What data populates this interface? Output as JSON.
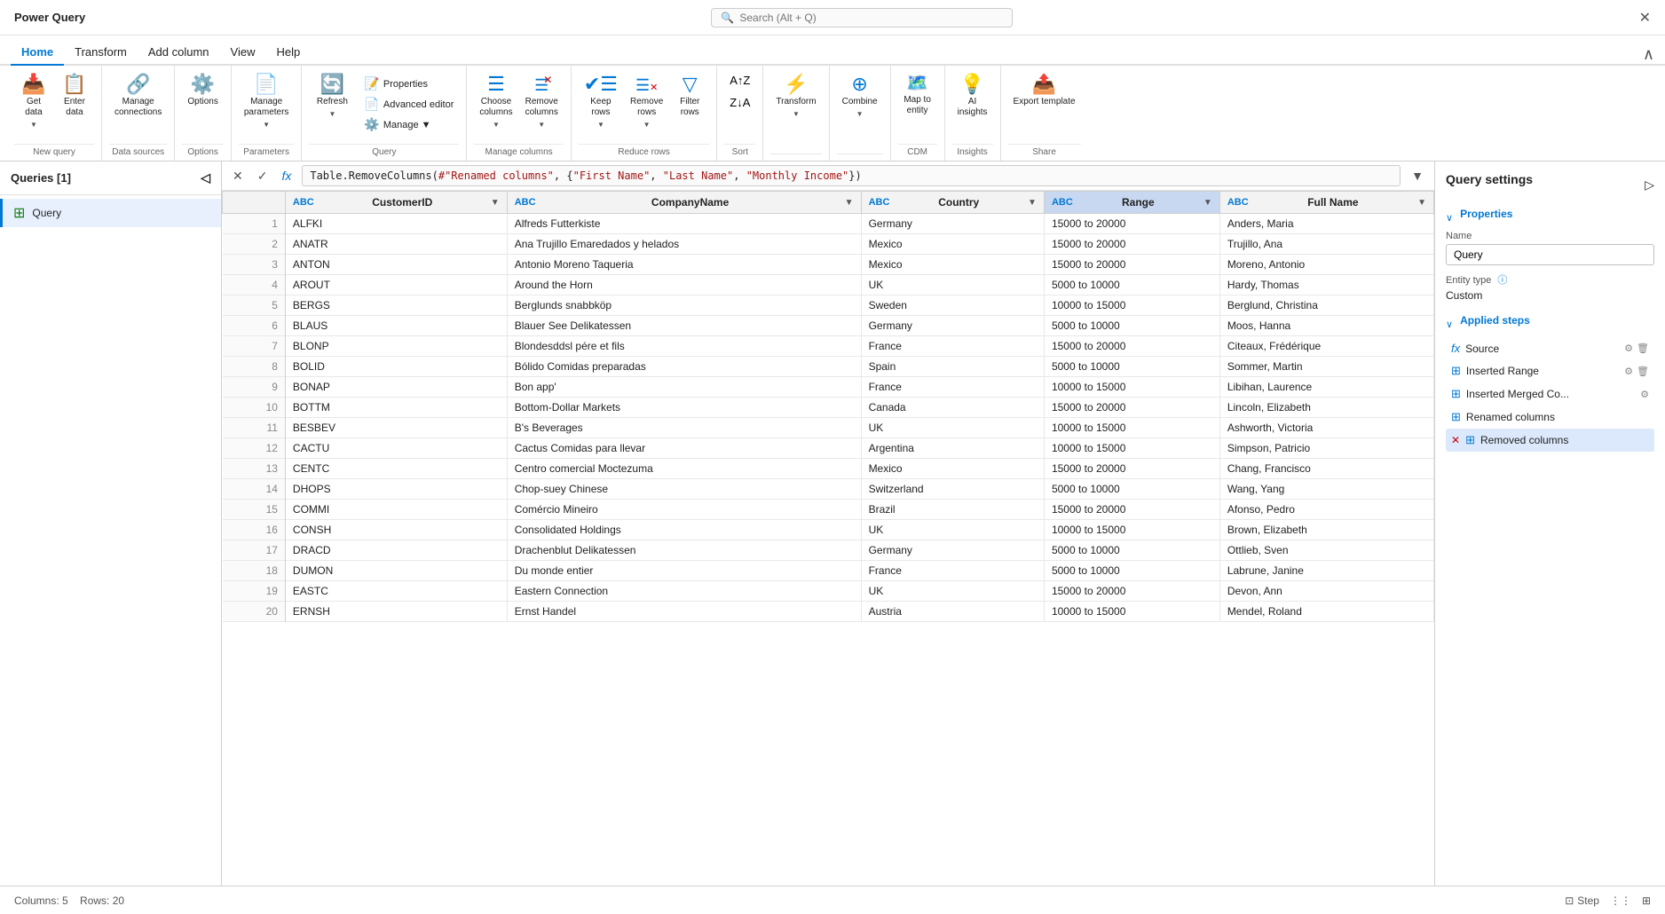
{
  "app": {
    "title": "Power Query",
    "search_placeholder": "Search (Alt + Q)"
  },
  "menu": {
    "items": [
      "Home",
      "Transform",
      "Add column",
      "View",
      "Help"
    ],
    "active": "Home"
  },
  "ribbon": {
    "groups": [
      {
        "label": "New query",
        "items": [
          {
            "id": "get-data",
            "icon": "📥",
            "label": "Get\ndata",
            "has_arrow": true
          },
          {
            "id": "enter-data",
            "icon": "📋",
            "label": "Enter\ndata",
            "has_arrow": false
          }
        ]
      },
      {
        "label": "Data sources",
        "items": [
          {
            "id": "manage-connections",
            "icon": "🔗",
            "label": "Manage\nconnections",
            "has_arrow": false
          }
        ]
      },
      {
        "label": "Options",
        "items": [
          {
            "id": "options",
            "icon": "⚙️",
            "label": "Options",
            "has_arrow": false
          }
        ]
      },
      {
        "label": "Parameters",
        "items": [
          {
            "id": "manage-parameters",
            "icon": "📄",
            "label": "Manage\nparameters",
            "has_arrow": true
          }
        ]
      },
      {
        "label": "Query",
        "items": [
          {
            "id": "refresh",
            "icon": "🔄",
            "label": "Refresh",
            "has_arrow": true
          },
          {
            "id": "properties",
            "icon": "📝",
            "label": "Properties",
            "has_arrow": false,
            "small": true
          },
          {
            "id": "advanced-editor",
            "icon": "📄",
            "label": "Advanced editor",
            "has_arrow": false,
            "small": true
          },
          {
            "id": "manage",
            "icon": "⚙️",
            "label": "Manage",
            "has_arrow": true,
            "small": true
          }
        ]
      },
      {
        "label": "Manage columns",
        "items": [
          {
            "id": "choose-columns",
            "icon": "☰",
            "label": "Choose\ncolumns",
            "has_arrow": true
          },
          {
            "id": "remove-columns",
            "icon": "✕☰",
            "label": "Remove\ncolumns",
            "has_arrow": true
          }
        ]
      },
      {
        "label": "Reduce rows",
        "items": [
          {
            "id": "keep-rows",
            "icon": "✔☰",
            "label": "Keep\nrows",
            "has_arrow": true
          },
          {
            "id": "remove-rows",
            "icon": "✕☰",
            "label": "Remove\nrows",
            "has_arrow": true
          },
          {
            "id": "filter-rows",
            "icon": "🔽",
            "label": "Filter\nrows",
            "has_arrow": false
          }
        ]
      },
      {
        "label": "Sort",
        "items": [
          {
            "id": "sort-asc",
            "icon": "↑Z",
            "label": "",
            "has_arrow": false
          },
          {
            "id": "sort-desc",
            "icon": "↓A",
            "label": "",
            "has_arrow": false
          }
        ]
      },
      {
        "label": "",
        "items": [
          {
            "id": "transform",
            "icon": "⚡",
            "label": "Transform",
            "has_arrow": true
          }
        ]
      },
      {
        "label": "",
        "items": [
          {
            "id": "combine",
            "icon": "⊕",
            "label": "Combine",
            "has_arrow": true
          }
        ]
      },
      {
        "label": "CDM",
        "items": [
          {
            "id": "map-to-entity",
            "icon": "🗺️",
            "label": "Map to\nentity",
            "has_arrow": false
          }
        ]
      },
      {
        "label": "Insights",
        "items": [
          {
            "id": "ai-insights",
            "icon": "💡",
            "label": "AI\ninsights",
            "has_arrow": false
          }
        ]
      },
      {
        "label": "Share",
        "items": [
          {
            "id": "export-template",
            "icon": "📤",
            "label": "Export template",
            "has_arrow": false
          }
        ]
      }
    ]
  },
  "queries_panel": {
    "title": "Queries [1]",
    "queries": [
      {
        "id": "query1",
        "label": "Query",
        "active": true
      }
    ]
  },
  "formula_bar": {
    "formula": "Table.RemoveColumns(#\"Renamed columns\", {\"First Name\", \"Last Name\", \"Monthly Income\"})"
  },
  "table": {
    "columns": [
      {
        "id": "customerid",
        "label": "CustomerID",
        "type": "ABC",
        "filter": true
      },
      {
        "id": "companyname",
        "label": "CompanyName",
        "type": "ABC",
        "filter": true
      },
      {
        "id": "country",
        "label": "Country",
        "type": "ABC",
        "filter": true
      },
      {
        "id": "range",
        "label": "Range",
        "type": "ABC",
        "filter": true,
        "highlighted": true
      },
      {
        "id": "fullname",
        "label": "Full Name",
        "type": "ABC",
        "filter": true
      }
    ],
    "rows": [
      {
        "num": 1,
        "customerid": "ALFKI",
        "companyname": "Alfreds Futterkiste",
        "country": "Germany",
        "range": "15000 to 20000",
        "fullname": "Anders, Maria"
      },
      {
        "num": 2,
        "customerid": "ANATR",
        "companyname": "Ana Trujillo Emaredados y helados",
        "country": "Mexico",
        "range": "15000 to 20000",
        "fullname": "Trujillo, Ana"
      },
      {
        "num": 3,
        "customerid": "ANTON",
        "companyname": "Antonio Moreno Taqueria",
        "country": "Mexico",
        "range": "15000 to 20000",
        "fullname": "Moreno, Antonio"
      },
      {
        "num": 4,
        "customerid": "AROUT",
        "companyname": "Around the Horn",
        "country": "UK",
        "range": "5000 to 10000",
        "fullname": "Hardy, Thomas"
      },
      {
        "num": 5,
        "customerid": "BERGS",
        "companyname": "Berglunds snabbköp",
        "country": "Sweden",
        "range": "10000 to 15000",
        "fullname": "Berglund, Christina"
      },
      {
        "num": 6,
        "customerid": "BLAUS",
        "companyname": "Blauer See Delikatessen",
        "country": "Germany",
        "range": "5000 to 10000",
        "fullname": "Moos, Hanna"
      },
      {
        "num": 7,
        "customerid": "BLONP",
        "companyname": "Blondesddsl pére et fils",
        "country": "France",
        "range": "15000 to 20000",
        "fullname": "Citeaux, Frédérique"
      },
      {
        "num": 8,
        "customerid": "BOLID",
        "companyname": "Bólido Comidas preparadas",
        "country": "Spain",
        "range": "5000 to 10000",
        "fullname": "Sommer, Martin"
      },
      {
        "num": 9,
        "customerid": "BONAP",
        "companyname": "Bon app'",
        "country": "France",
        "range": "10000 to 15000",
        "fullname": "Libihan, Laurence"
      },
      {
        "num": 10,
        "customerid": "BOTTM",
        "companyname": "Bottom-Dollar Markets",
        "country": "Canada",
        "range": "15000 to 20000",
        "fullname": "Lincoln, Elizabeth"
      },
      {
        "num": 11,
        "customerid": "BESBEV",
        "companyname": "B's Beverages",
        "country": "UK",
        "range": "10000 to 15000",
        "fullname": "Ashworth, Victoria"
      },
      {
        "num": 12,
        "customerid": "CACTU",
        "companyname": "Cactus Comidas para llevar",
        "country": "Argentina",
        "range": "10000 to 15000",
        "fullname": "Simpson, Patricio"
      },
      {
        "num": 13,
        "customerid": "CENTC",
        "companyname": "Centro comercial Moctezuma",
        "country": "Mexico",
        "range": "15000 to 20000",
        "fullname": "Chang, Francisco"
      },
      {
        "num": 14,
        "customerid": "DHOPS",
        "companyname": "Chop-suey Chinese",
        "country": "Switzerland",
        "range": "5000 to 10000",
        "fullname": "Wang, Yang"
      },
      {
        "num": 15,
        "customerid": "COMMI",
        "companyname": "Comércio Mineiro",
        "country": "Brazil",
        "range": "15000 to 20000",
        "fullname": "Afonso, Pedro"
      },
      {
        "num": 16,
        "customerid": "CONSH",
        "companyname": "Consolidated Holdings",
        "country": "UK",
        "range": "10000 to 15000",
        "fullname": "Brown, Elizabeth"
      },
      {
        "num": 17,
        "customerid": "DRACD",
        "companyname": "Drachenblut Delikatessen",
        "country": "Germany",
        "range": "5000 to 10000",
        "fullname": "Ottlieb, Sven"
      },
      {
        "num": 18,
        "customerid": "DUMON",
        "companyname": "Du monde entier",
        "country": "France",
        "range": "5000 to 10000",
        "fullname": "Labrune, Janine"
      },
      {
        "num": 19,
        "customerid": "EASTC",
        "companyname": "Eastern Connection",
        "country": "UK",
        "range": "15000 to 20000",
        "fullname": "Devon, Ann"
      },
      {
        "num": 20,
        "customerid": "ERNSH",
        "companyname": "Ernst Handel",
        "country": "Austria",
        "range": "10000 to 15000",
        "fullname": "Mendel, Roland"
      }
    ]
  },
  "query_settings": {
    "title": "Query settings",
    "properties_label": "Properties",
    "name_label": "Name",
    "name_value": "Query",
    "entity_type_label": "Entity type",
    "entity_type_value": "Custom",
    "applied_steps_label": "Applied steps",
    "steps": [
      {
        "id": "source",
        "label": "Source",
        "has_gear": true,
        "has_delete": true,
        "active": false,
        "error": false
      },
      {
        "id": "inserted-range",
        "label": "Inserted Range",
        "has_gear": true,
        "has_delete": true,
        "active": false,
        "error": false
      },
      {
        "id": "inserted-merged",
        "label": "Inserted Merged Co...",
        "has_gear": true,
        "has_delete": false,
        "active": false,
        "error": false
      },
      {
        "id": "renamed-columns",
        "label": "Renamed columns",
        "has_gear": false,
        "has_delete": false,
        "active": false,
        "error": false
      },
      {
        "id": "removed-columns",
        "label": "Removed columns",
        "has_gear": false,
        "has_delete": false,
        "active": true,
        "error": true
      }
    ]
  },
  "status_bar": {
    "columns_label": "Columns: 5",
    "rows_label": "Rows: 20",
    "step_label": "Step",
    "diagram_label": "",
    "grid_label": ""
  }
}
